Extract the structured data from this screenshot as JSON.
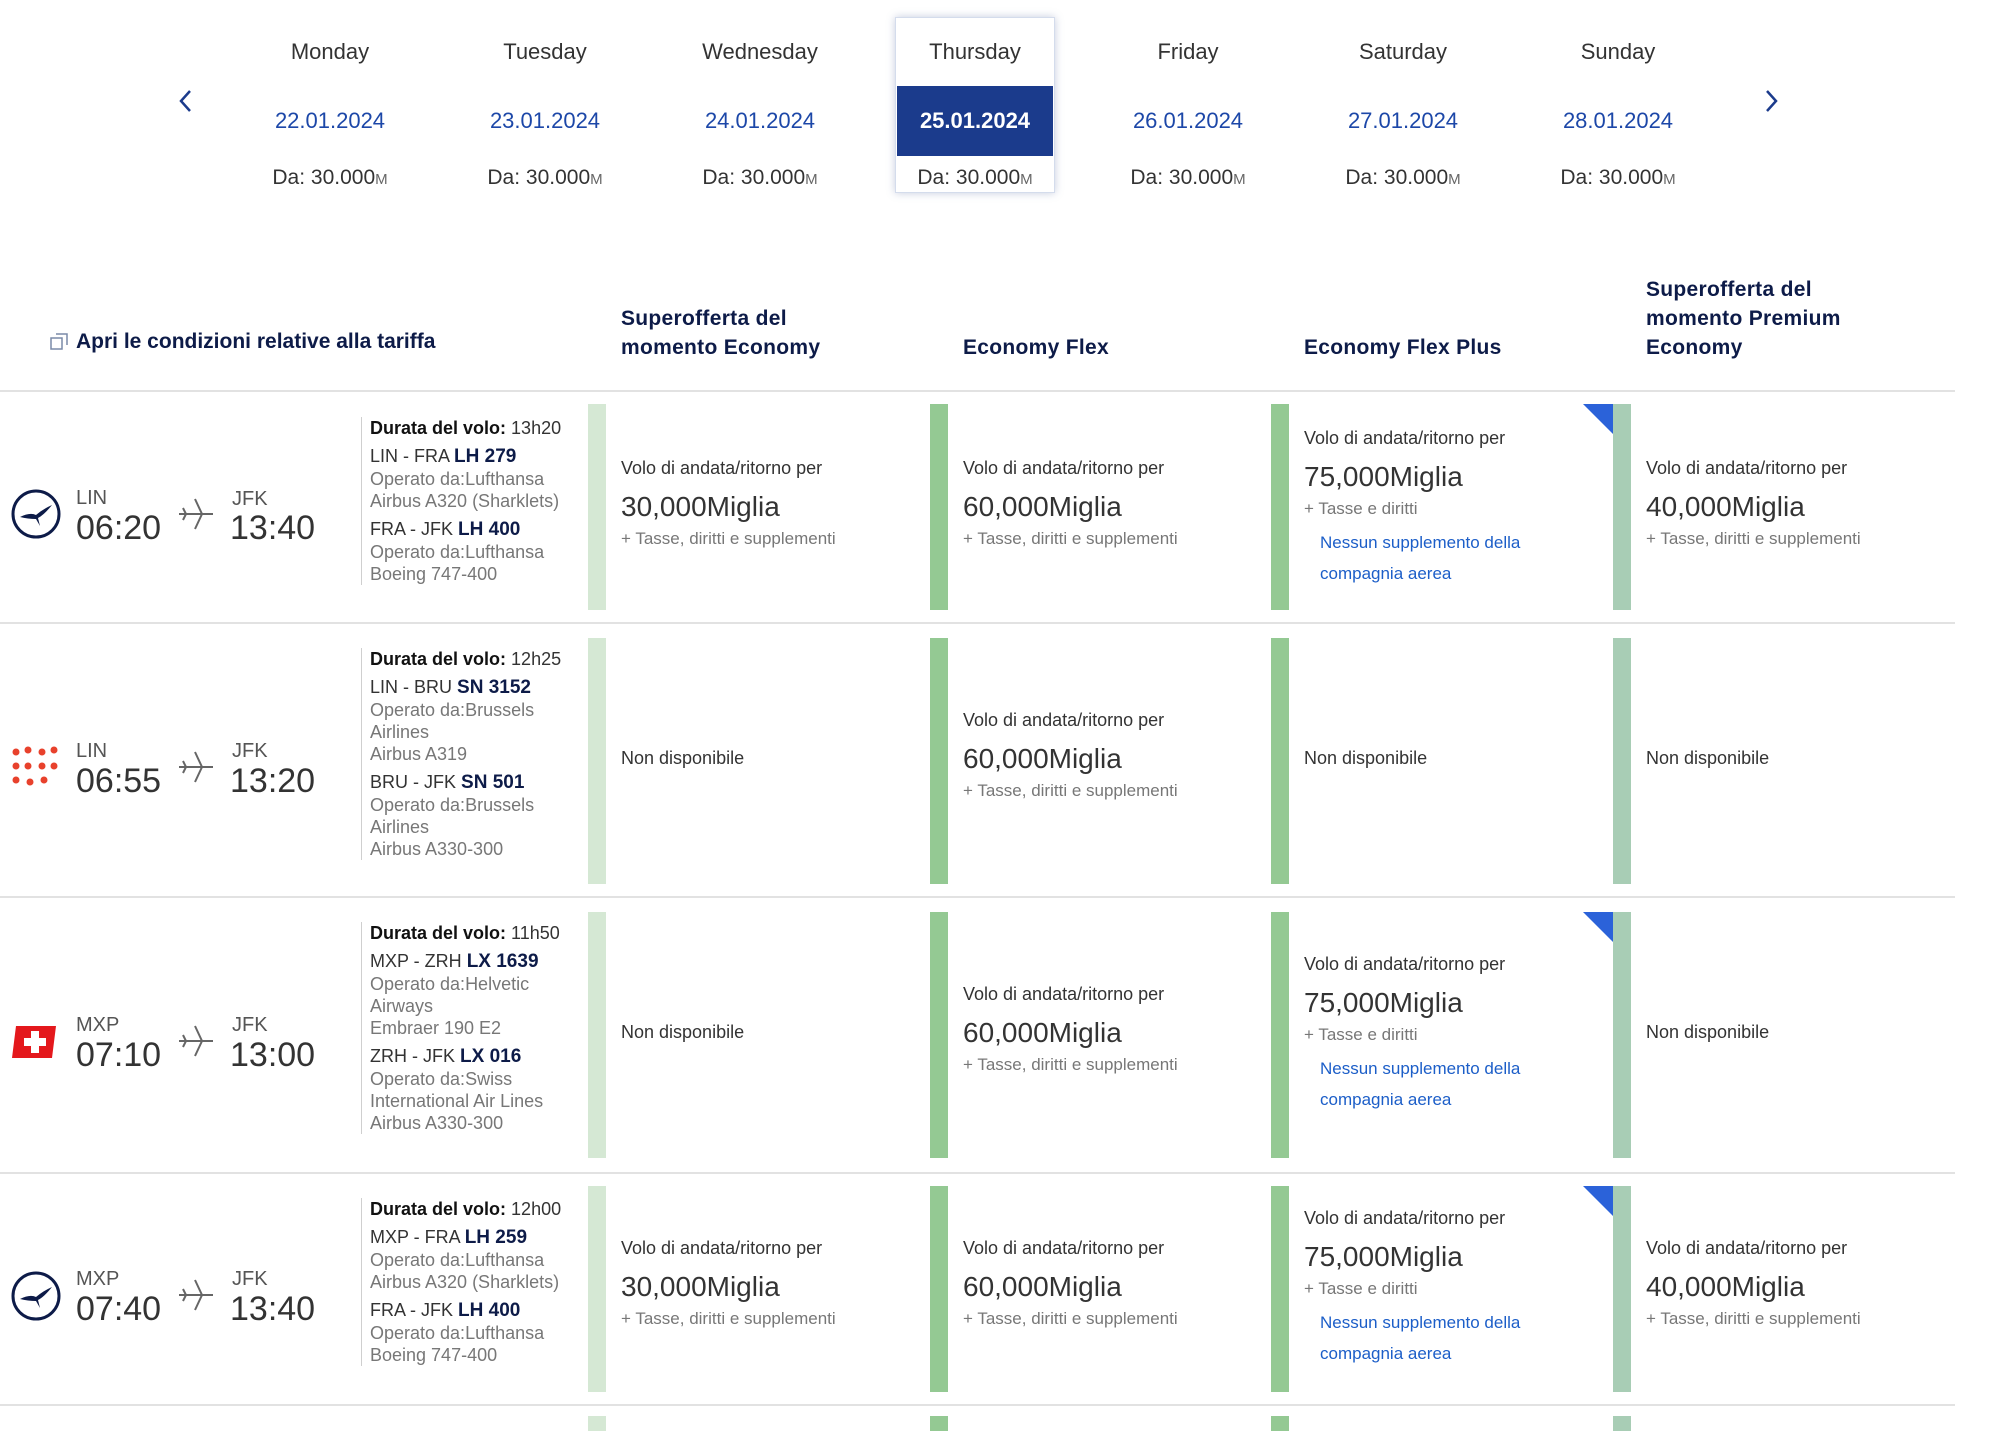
{
  "date_nav": {
    "prev_icon": "chevron-left-icon",
    "next_icon": "chevron-right-icon",
    "days": [
      {
        "name": "Monday",
        "date": "22.01.2024",
        "price": "Da: 30.000",
        "unit": "M"
      },
      {
        "name": "Tuesday",
        "date": "23.01.2024",
        "price": "Da: 30.000",
        "unit": "M"
      },
      {
        "name": "Wednesday",
        "date": "24.01.2024",
        "price": "Da: 30.000",
        "unit": "M"
      },
      {
        "name": "Thursday",
        "date": "25.01.2024",
        "price": "Da: 30.000",
        "unit": "M"
      },
      {
        "name": "Friday",
        "date": "26.01.2024",
        "price": "Da: 30.000",
        "unit": "M"
      },
      {
        "name": "Saturday",
        "date": "27.01.2024",
        "price": "Da: 30.000",
        "unit": "M"
      },
      {
        "name": "Sunday",
        "date": "28.01.2024",
        "price": "Da: 30.000",
        "unit": "M"
      }
    ],
    "selected": "Thursday"
  },
  "header": {
    "conditions_link": "Apri le condizioni relative alla tariffa",
    "fares": [
      "Superofferta del momento Economy",
      "Economy Flex",
      "Economy Flex Plus",
      "Superofferta del momento Premium Economy"
    ]
  },
  "colors": {
    "brand_navy": "#1b3b8c",
    "link_blue": "#1c5ec8",
    "bar_green": "#94c993"
  },
  "flights": [
    {
      "airline_icon": "lufthansa-crane-icon",
      "from": "LIN",
      "dep": "06:20",
      "to": "JFK",
      "arr": "13:40",
      "duration_label": "Durata del volo:",
      "duration": "13h20",
      "seg1_route": "LIN - FRA",
      "seg1_flight": "LH 279",
      "seg1_op": "Operato da:Lufthansa",
      "seg1_aircraft": "Airbus A320 (Sharklets)",
      "seg2_route": "FRA - JFK",
      "seg2_flight": "LH 400",
      "seg2_op": "Operato da:Lufthansa",
      "seg2_aircraft": "Boeing 747-400",
      "fare1": {
        "label": "Volo di andata/ritorno per",
        "amount": "30,000Miglia",
        "tax": "+ Tasse, diritti e supplementi"
      },
      "fare2": {
        "label": "Volo di andata/ritorno per",
        "amount": "60,000Miglia",
        "tax": "+ Tasse, diritti e supplementi"
      },
      "fare3": {
        "label": "Volo di andata/ritorno per",
        "amount": "75,000Miglia",
        "tax": "+ Tasse e diritti",
        "note": "Nessun supplemento della compagnia aerea"
      },
      "fare4": {
        "label": "Volo di andata/ritorno per",
        "amount": "40,000Miglia",
        "tax": "+ Tasse, diritti e supplementi"
      }
    },
    {
      "airline_icon": "brussels-airlines-dots-icon",
      "from": "LIN",
      "dep": "06:55",
      "to": "JFK",
      "arr": "13:20",
      "duration_label": "Durata del volo:",
      "duration": "12h25",
      "seg1_route": "LIN - BRU",
      "seg1_flight": "SN 3152",
      "seg1_op": "Operato da:Brussels Airlines",
      "seg1_aircraft": "Airbus A319",
      "seg2_route": "BRU - JFK",
      "seg2_flight": "SN 501",
      "seg2_op": "Operato da:Brussels Airlines",
      "seg2_aircraft": "Airbus A330-300",
      "fare1": {
        "na": "Non disponibile"
      },
      "fare2": {
        "label": "Volo di andata/ritorno per",
        "amount": "60,000Miglia",
        "tax": "+ Tasse, diritti e supplementi"
      },
      "fare3": {
        "na": "Non disponibile"
      },
      "fare4": {
        "na": "Non disponibile"
      }
    },
    {
      "airline_icon": "swiss-cross-icon",
      "from": "MXP",
      "dep": "07:10",
      "to": "JFK",
      "arr": "13:00",
      "duration_label": "Durata del volo:",
      "duration": "11h50",
      "seg1_route": "MXP - ZRH",
      "seg1_flight": "LX 1639",
      "seg1_op": "Operato da:Helvetic Airways",
      "seg1_aircraft": "Embraer 190 E2",
      "seg2_route": "ZRH - JFK",
      "seg2_flight": "LX 016",
      "seg2_op": "Operato da:Swiss International Air Lines",
      "seg2_aircraft": "Airbus A330-300",
      "fare1": {
        "na": "Non disponibile"
      },
      "fare2": {
        "label": "Volo di andata/ritorno per",
        "amount": "60,000Miglia",
        "tax": "+ Tasse, diritti e supplementi"
      },
      "fare3": {
        "label": "Volo di andata/ritorno per",
        "amount": "75,000Miglia",
        "tax": "+ Tasse e diritti",
        "note": "Nessun supplemento della compagnia aerea"
      },
      "fare4": {
        "na": "Non disponibile"
      }
    },
    {
      "airline_icon": "lufthansa-crane-icon",
      "from": "MXP",
      "dep": "07:40",
      "to": "JFK",
      "arr": "13:40",
      "duration_label": "Durata del volo:",
      "duration": "12h00",
      "seg1_route": "MXP - FRA",
      "seg1_flight": "LH 259",
      "seg1_op": "Operato da:Lufthansa",
      "seg1_aircraft": "Airbus A320 (Sharklets)",
      "seg2_route": "FRA - JFK",
      "seg2_flight": "LH 400",
      "seg2_op": "Operato da:Lufthansa",
      "seg2_aircraft": "Boeing 747-400",
      "fare1": {
        "label": "Volo di andata/ritorno per",
        "amount": "30,000Miglia",
        "tax": "+ Tasse, diritti e supplementi"
      },
      "fare2": {
        "label": "Volo di andata/ritorno per",
        "amount": "60,000Miglia",
        "tax": "+ Tasse, diritti e supplementi"
      },
      "fare3": {
        "label": "Volo di andata/ritorno per",
        "amount": "75,000Miglia",
        "tax": "+ Tasse e diritti",
        "note": "Nessun supplemento della compagnia aerea"
      },
      "fare4": {
        "label": "Volo di andata/ritorno per",
        "amount": "40,000Miglia",
        "tax": "+ Tasse, diritti e supplementi"
      }
    }
  ]
}
